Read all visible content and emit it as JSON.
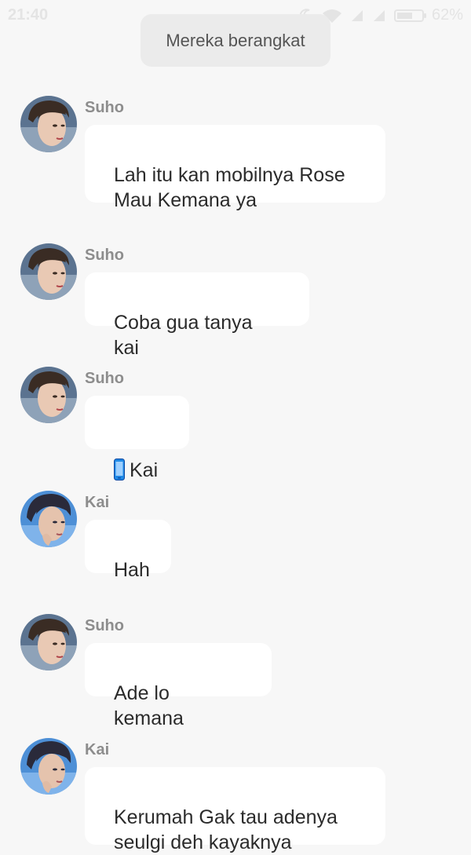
{
  "status_bar": {
    "time": "21:40",
    "battery_percent": "62%",
    "battery_level": 0.62,
    "icons": [
      "moon-icon",
      "wifi-icon",
      "signal-icon",
      "signal-icon-2",
      "battery-icon"
    ]
  },
  "system_message": "Mereka berangkat",
  "messages": [
    {
      "sender": "Suho",
      "text": "Lah itu kan mobilnya Rose\nMau Kemana ya",
      "avatar": "suho-avatar"
    },
    {
      "sender": "Suho",
      "text": "Coba gua tanya kai",
      "avatar": "suho-avatar"
    },
    {
      "sender": "Suho",
      "text": "Kai",
      "avatar": "suho-avatar",
      "icon": "mobile-phone-icon"
    },
    {
      "sender": "Kai",
      "text": "Hah",
      "avatar": "kai-avatar"
    },
    {
      "sender": "Suho",
      "text": "Ade lo kemana",
      "avatar": "suho-avatar"
    },
    {
      "sender": "Kai",
      "text": "Kerumah Gak tau adenya\nseulgi deh kayaknya",
      "avatar": "kai-avatar"
    }
  ],
  "colors": {
    "background": "#f7f7f7",
    "bubble": "#ffffff",
    "system_pill": "#ebebeb",
    "sender_name": "#8d8d8d",
    "message_text": "#2b2b2b",
    "phone_icon": "#1e88e5"
  }
}
